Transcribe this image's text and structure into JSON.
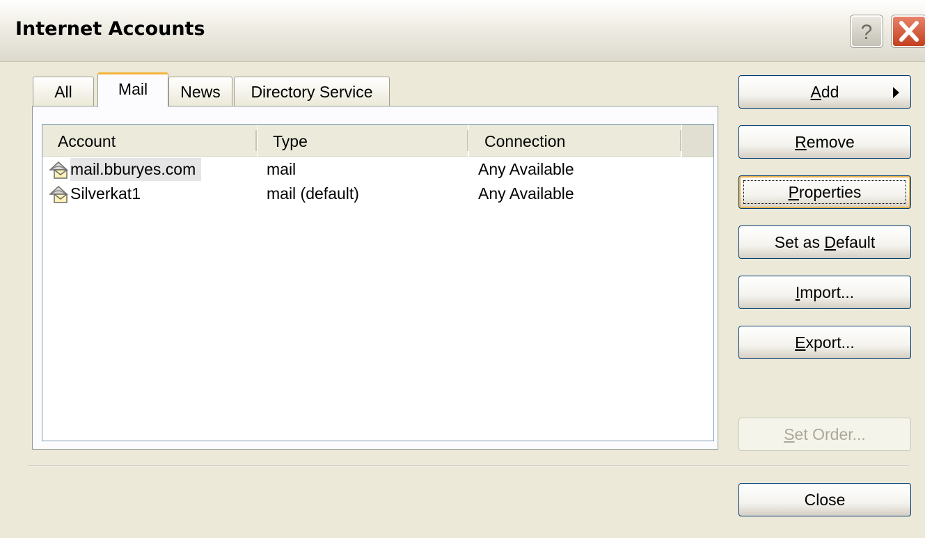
{
  "window": {
    "title": "Internet Accounts"
  },
  "titlebar": {
    "help_icon": "question-mark-icon",
    "close_icon": "close-x-icon"
  },
  "tabs": [
    {
      "label": "All",
      "active": false
    },
    {
      "label": "Mail",
      "active": true
    },
    {
      "label": "News",
      "active": false
    },
    {
      "label": "Directory Service",
      "active": false
    }
  ],
  "list": {
    "columns": [
      "Account",
      "Type",
      "Connection"
    ],
    "rows": [
      {
        "icon": "mail-account-icon",
        "account": "mail.bburyes.com",
        "type": "mail",
        "connection": "Any Available",
        "selected": true
      },
      {
        "icon": "mail-account-icon",
        "account": "Silverkat1",
        "type": "mail (default)",
        "connection": "Any Available",
        "selected": false
      }
    ]
  },
  "buttons": {
    "add": {
      "pre": "",
      "key": "A",
      "post": "dd"
    },
    "remove": {
      "pre": "",
      "key": "R",
      "post": "emove"
    },
    "properties": {
      "pre": "",
      "key": "P",
      "post": "roperties"
    },
    "set_default": {
      "pre": "Set as ",
      "key": "D",
      "post": "efault"
    },
    "import": {
      "pre": "",
      "key": "I",
      "post": "mport..."
    },
    "export": {
      "pre": "",
      "key": "E",
      "post": "xport..."
    },
    "set_order": {
      "pre": "",
      "key": "S",
      "post": "et Order..."
    },
    "close": "Close"
  },
  "colors": {
    "tab_active_accent": "#f5b33b",
    "button_border": "#003c74",
    "disabled_text": "#aca899"
  }
}
